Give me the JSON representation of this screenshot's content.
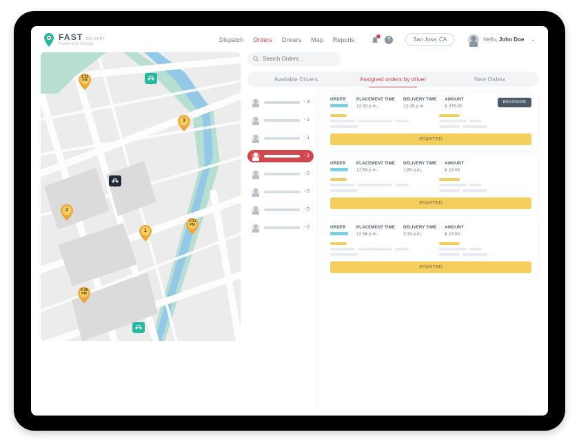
{
  "logo": {
    "brand_first": "FAST",
    "brand_second": "DELIVERY",
    "tagline": "Powered by Shipday"
  },
  "nav": {
    "dispatch": "Dispatch",
    "orders": "Orders",
    "drivers": "Drivers",
    "map": "Map",
    "reports": "Reports"
  },
  "header": {
    "location": "San Jose, CA",
    "hello": "Hello, ",
    "username": "John Doe"
  },
  "search": {
    "placeholder": "Search Orders .."
  },
  "tabs": {
    "available": "Available Drivers",
    "assigned": "Assigned orders by driver",
    "new": "New Orders"
  },
  "driver_list": [
    {
      "count": "- 3"
    },
    {
      "count": "- 1"
    },
    {
      "count": "- 1"
    },
    {
      "count": "- 1",
      "selected": true
    },
    {
      "count": "- 0"
    },
    {
      "count": "- 0"
    },
    {
      "count": "- 0"
    },
    {
      "count": "- 0"
    }
  ],
  "order_labels": {
    "order": "ORDER",
    "placement": "PLACEMENT TIME",
    "delivery": "DELIVERY TIME",
    "amount": "AMOUNT",
    "reassign": "REASSIGN",
    "started": "STARTED"
  },
  "orders": [
    {
      "placement": "12:32 p.m.",
      "delivery": "12:25 p.m.",
      "amount": "£ 375.00",
      "reassign": true
    },
    {
      "placement": "12:59 p.m.",
      "delivery": "1:55 p.m.",
      "amount": "£ 15.00"
    },
    {
      "placement": "12:58 p.m.",
      "delivery": "3:33 p.m.",
      "amount": "£ 15.00"
    }
  ],
  "map_markers": {
    "m1": "1:55\nPM",
    "m2": "3",
    "m3": "2",
    "m4": "1",
    "m5": "3:33\nPM",
    "m6": "2:48\nPM"
  }
}
